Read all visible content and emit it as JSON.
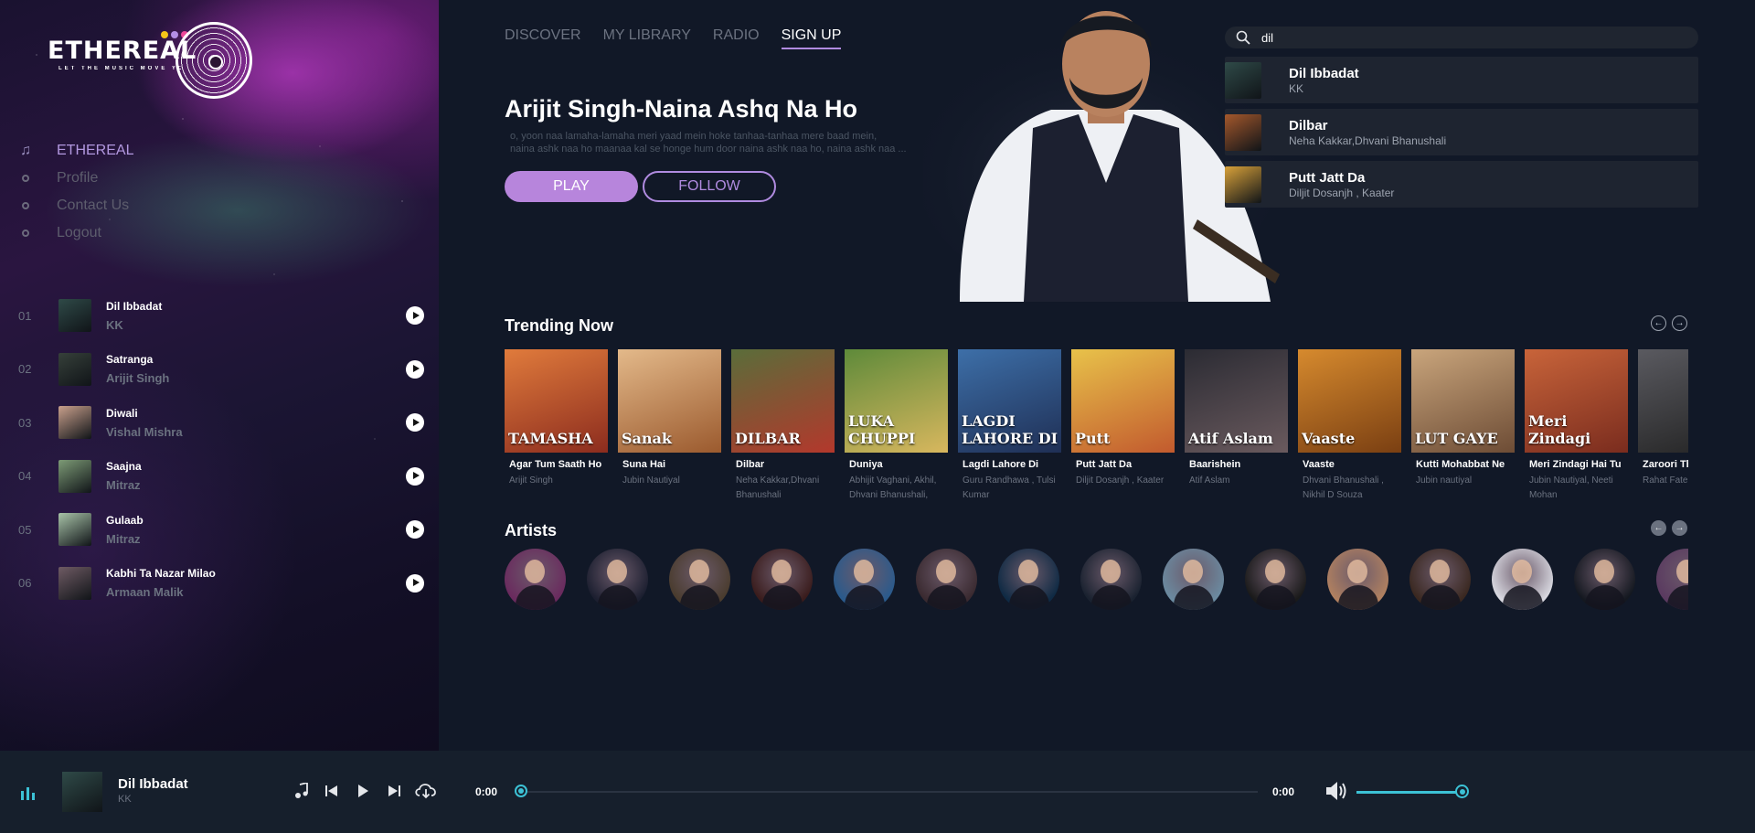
{
  "brand": {
    "name": "ETHEREAL",
    "tagline": "LET THE MUSIC MOVE YOU",
    "dot_colors": [
      "#f5c518",
      "#b48ee6",
      "#ec4899"
    ]
  },
  "sidebar": {
    "menu": [
      {
        "label": "ETHEREAL",
        "icon": "music-note-icon",
        "active": true
      },
      {
        "label": "Profile",
        "icon": "circle-icon"
      },
      {
        "label": "Contact Us",
        "icon": "circle-icon"
      },
      {
        "label": "Logout",
        "icon": "circle-icon"
      }
    ],
    "playlist": [
      {
        "num": "01",
        "title": "Dil Ibbadat",
        "artist": "KK",
        "cover": "#2f4a48"
      },
      {
        "num": "02",
        "title": "Satranga",
        "artist": "Arijit Singh",
        "cover": "#36403a"
      },
      {
        "num": "03",
        "title": "Diwali",
        "artist": "Vishal Mishra",
        "cover": "#c9a08c"
      },
      {
        "num": "04",
        "title": "Saajna",
        "artist": "Mitraz",
        "cover": "#7d9b76"
      },
      {
        "num": "05",
        "title": "Gulaab",
        "artist": "Mitraz",
        "cover": "#a8c3a8"
      },
      {
        "num": "06",
        "title": "Kabhi Ta Nazar Milao",
        "artist": "Armaan Malik",
        "cover": "#6f5b64"
      }
    ]
  },
  "topnav": [
    {
      "label": "DISCOVER"
    },
    {
      "label": "MY LIBRARY"
    },
    {
      "label": "RADIO"
    },
    {
      "label": "SIGN UP",
      "active": true
    }
  ],
  "hero": {
    "title": "Arijit Singh-Naina Ashq Na Ho",
    "lyrics_line1": "o, yoon naa lamaha-lamaha meri yaad mein hoke tanhaa-tanhaa mere baad mein,",
    "lyrics_line2": "naina ashk naa ho maanaa kal se honge hum door naina ashk naa ho, naina ashk naa ...",
    "play_label": "PLAY",
    "follow_label": "FOLLOW"
  },
  "search": {
    "value": "dil",
    "results": [
      {
        "title": "Dil Ibbadat",
        "artist": "KK",
        "cover": "#2f4a48"
      },
      {
        "title": "Dilbar",
        "artist": "Neha Kakkar,Dhvani Bhanushali",
        "cover": "#a5582c"
      },
      {
        "title": "Putt Jatt Da",
        "artist": "Diljit Dosanjh , Kaater",
        "cover": "#d9a23a"
      }
    ]
  },
  "trending": {
    "title": "Trending Now",
    "items": [
      {
        "title": "Agar Tum Saath Ho",
        "artist": "Arijit Singh",
        "art": "TAMASHA",
        "colors": [
          "#e07b3c",
          "#8c2c1e"
        ]
      },
      {
        "title": "Suna Hai",
        "artist": "Jubin Nautiyal",
        "art": "Sanak",
        "colors": [
          "#e3b98a",
          "#9b5a2e"
        ]
      },
      {
        "title": "Dilbar",
        "artist": "Neha Kakkar,Dhvani Bhanushali",
        "art": "DILBAR",
        "colors": [
          "#5a6d3a",
          "#b3382c"
        ]
      },
      {
        "title": "Duniya",
        "artist": "Abhijit Vaghani, Akhil, Dhvani Bhanushali,",
        "art": "LUKA CHUPPI",
        "colors": [
          "#5e8a3a",
          "#d8b75e"
        ]
      },
      {
        "title": "Lagdi Lahore Di",
        "artist": "Guru Randhawa , Tulsi Kumar",
        "art": "LAGDI LAHORE DI",
        "colors": [
          "#3d6fa8",
          "#1f2f55"
        ]
      },
      {
        "title": "Putt Jatt Da",
        "artist": "Diljit Dosanjh , Kaater",
        "art": "Putt",
        "colors": [
          "#e8c24a",
          "#c25a2e"
        ]
      },
      {
        "title": "Baarishein",
        "artist": "Atif Aslam",
        "art": "Atif Aslam",
        "colors": [
          "#2b2b33",
          "#6a5a5e"
        ]
      },
      {
        "title": "Vaaste",
        "artist": "Dhvani Bhanushali , Nikhil D Souza",
        "art": "Vaaste",
        "colors": [
          "#d68a2e",
          "#7a3f12"
        ]
      },
      {
        "title": "Kutti Mohabbat Ne",
        "artist": "Jubin nautiyal",
        "art": "LUT GAYE",
        "colors": [
          "#c9a57c",
          "#6d4c35"
        ]
      },
      {
        "title": "Meri Zindagi Hai Tu",
        "artist": "Jubin Nautiyal, Neeti Mohan",
        "art": "Meri Zindagi",
        "colors": [
          "#c8643a",
          "#7a2c1e"
        ]
      },
      {
        "title": "Zaroori Tha",
        "artist": "Rahat Fateh",
        "art": "",
        "colors": [
          "#5a5a60",
          "#222"
        ]
      }
    ]
  },
  "artists": {
    "title": "Artists",
    "items": [
      {
        "color": "#6a2a5e"
      },
      {
        "color": "#1c1f30"
      },
      {
        "color": "#4a3c2e"
      },
      {
        "color": "#3a1c1c"
      },
      {
        "color": "#2a5a8c"
      },
      {
        "color": "#3a2a30"
      },
      {
        "color": "#0f2a44"
      },
      {
        "color": "#1a2230"
      },
      {
        "color": "#6b8aa0"
      },
      {
        "color": "#1a1a1a"
      },
      {
        "color": "#b08060"
      },
      {
        "color": "#3a2820"
      },
      {
        "color": "#d8d8e0"
      },
      {
        "color": "#141820"
      },
      {
        "color": "#5a3a60"
      }
    ]
  },
  "player": {
    "title": "Dil Ibbadat",
    "artist": "KK",
    "current_time": "0:00",
    "total_time": "0:00",
    "progress_fraction": 0,
    "volume_fraction": 1
  },
  "colors": {
    "accent": "#b785dc",
    "player_accent": "#3cc2d6",
    "bg": "#111827"
  }
}
